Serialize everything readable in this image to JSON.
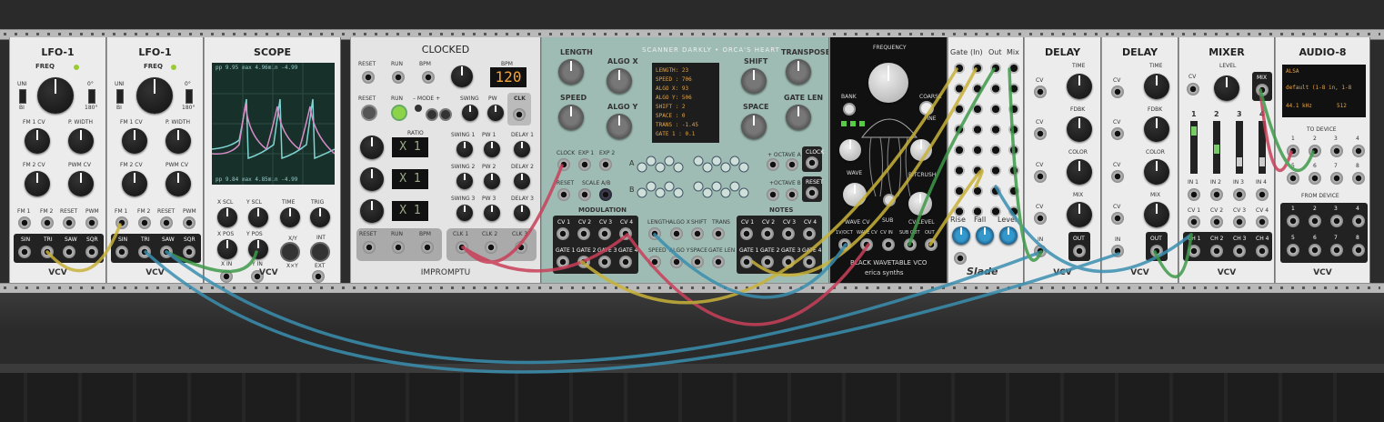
{
  "modules": {
    "lfo1a": {
      "title": "LFO-1",
      "freq": "FREQ",
      "uni": "UNI",
      "bi": "BI",
      "deg0": "0°",
      "deg180": "180°",
      "fm1cv": "FM 1 CV",
      "pwidth": "P. WIDTH",
      "fm2cv": "FM 2 CV",
      "pwmcv": "PWM CV",
      "ports": [
        "FM 1",
        "FM 2",
        "RESET",
        "PWM"
      ],
      "outs": [
        "SIN",
        "TRI",
        "SAW",
        "SQR"
      ],
      "brand": "VCV"
    },
    "lfo1b": {
      "title": "LFO-1",
      "freq": "FREQ",
      "uni": "UNI",
      "bi": "BI",
      "deg0": "0°",
      "deg180": "180°",
      "fm1cv": "FM 1 CV",
      "pwidth": "P. WIDTH",
      "fm2cv": "FM 2 CV",
      "pwmcv": "PWM CV",
      "ports": [
        "FM 1",
        "FM 2",
        "RESET",
        "PWM"
      ],
      "outs": [
        "SIN",
        "TRI",
        "SAW",
        "SQR"
      ],
      "brand": "VCV"
    },
    "scope": {
      "title": "SCOPE",
      "top_readout": "pp  9.95 max  4.96min -4.99",
      "bottom_readout": "pp  9.84 max  4.85min -4.99",
      "labels": [
        "X SCL",
        "Y SCL",
        "TIME",
        "TRIG",
        "X POS",
        "Y POS",
        "X IN",
        "Y IN"
      ],
      "xy": "X/Y",
      "xxy": "X×Y",
      "int": "INT",
      "ext": "EXT",
      "brand": "VCV"
    },
    "clocked": {
      "title": "CLOCKED",
      "reset": "RESET",
      "run": "RUN",
      "bpm": "BPM",
      "bpm_value": "120",
      "mode": "– MODE +",
      "ratio": "RATIO",
      "swing": "SWING",
      "pw": "PW",
      "clk": "CLK",
      "ratio_values": [
        "X 1",
        "X 1",
        "X 1"
      ],
      "swings": [
        "SWING 1",
        "SWING 2",
        "SWING 3"
      ],
      "pws": [
        "PW 1",
        "PW 2",
        "PW 3"
      ],
      "delays": [
        "DELAY 1",
        "DELAY 2",
        "DELAY 3"
      ],
      "bottom": [
        "RESET",
        "RUN",
        "BPM",
        "CLK 1",
        "CLK 2",
        "CLK 3"
      ],
      "brand": "IMPROMPTU"
    },
    "scanner": {
      "title": "SCANNER DARKLY • ORCA'S HEART",
      "length": "LENGTH",
      "algox": "ALGO X",
      "shift": "SHIFT",
      "transpose": "TRANSPOSE",
      "speed": "SPEED",
      "algoy": "ALGO Y",
      "space": "SPACE",
      "gatelen": "GATE LEN",
      "display": [
        "LENGTH: 23",
        "SPEED : 706",
        "ALGO X: 93",
        "ALGO Y: 506",
        "SHIFT : 2",
        "SPACE : 0",
        "TRANS : -1.45",
        "GATE 1 : 0.1"
      ],
      "clock": "CLOCK",
      "exp1": "EXP 1",
      "exp2": "EXP 2",
      "reset": "RESET",
      "scale": "SCALE A/B",
      "modulation": "MODULATION",
      "notes": "NOTES",
      "octA": "+ OCTAVE A",
      "octB": "+OCTAVE B",
      "a": "A",
      "b": "B",
      "cvs": [
        "CV 1",
        "CV 2",
        "CV 3",
        "CV 4"
      ],
      "gates": [
        "GATE 1",
        "GATE 2",
        "GATE 3",
        "GATE 4"
      ],
      "mod_ins": [
        "LENGTH",
        "ALGO X",
        "SHIFT",
        "TRANS",
        "SPEED",
        "ALGO Y",
        "SPACE",
        "GATE LEN"
      ]
    },
    "wavetable": {
      "title": "BLACK WAVETABLE VCO",
      "frequency": "FREQUENCY",
      "bank": "BANK",
      "coarse": "COARSE",
      "fine": "FINE",
      "wave": "WAVE",
      "bitcrush": "BITCRUSH",
      "sub": "SUB",
      "wavecv": "WAVE CV",
      "cvlevel": "CV LEVEL",
      "ports": [
        "1V/OCT",
        "WAVE CV",
        "CV IN",
        "SUB OUT",
        "OUT"
      ],
      "brand": "erica synths"
    },
    "slade": {
      "headers": [
        "Gate",
        "(In)",
        "Out",
        "Mix"
      ],
      "bottom": [
        "Rise",
        "Fall",
        "Level"
      ],
      "brand": "Slade"
    },
    "delay1": {
      "title": "DELAY",
      "time": "TIME",
      "fdbk": "FDBK",
      "color": "COLOR",
      "mix": "MIX",
      "cv": "CV",
      "in": "IN",
      "out": "OUT",
      "brand": "VCV"
    },
    "delay2": {
      "title": "DELAY",
      "time": "TIME",
      "fdbk": "FDBK",
      "color": "COLOR",
      "mix": "MIX",
      "cv": "CV",
      "in": "IN",
      "out": "OUT",
      "brand": "VCV"
    },
    "mixer": {
      "title": "MIXER",
      "level": "LEVEL",
      "cv": "CV",
      "mix": "MIX",
      "channels": [
        "1",
        "2",
        "3",
        "4"
      ],
      "ins": [
        "IN 1",
        "IN 2",
        "IN 3",
        "IN 4"
      ],
      "cvs": [
        "CV 1",
        "CV 2",
        "CV 3",
        "CV 4"
      ],
      "chs": [
        "CH 1",
        "CH 2",
        "CH 3",
        "CH 4"
      ],
      "brand": "VCV"
    },
    "audio": {
      "title": "AUDIO-8",
      "driver": "ALSA",
      "device": "default (1-8 in, 1-8",
      "rate": "44.1 kHz",
      "block": "512",
      "to_device": "TO DEVICE",
      "from_device": "FROM DEVICE",
      "nums": [
        "1",
        "2",
        "3",
        "4",
        "5",
        "6",
        "7",
        "8"
      ],
      "brand": "VCV"
    }
  },
  "cable_colors": {
    "yellow": "#c9b23a",
    "green": "#3f9a4a",
    "blue": "#3a8fb0",
    "red": "#c9405a"
  }
}
